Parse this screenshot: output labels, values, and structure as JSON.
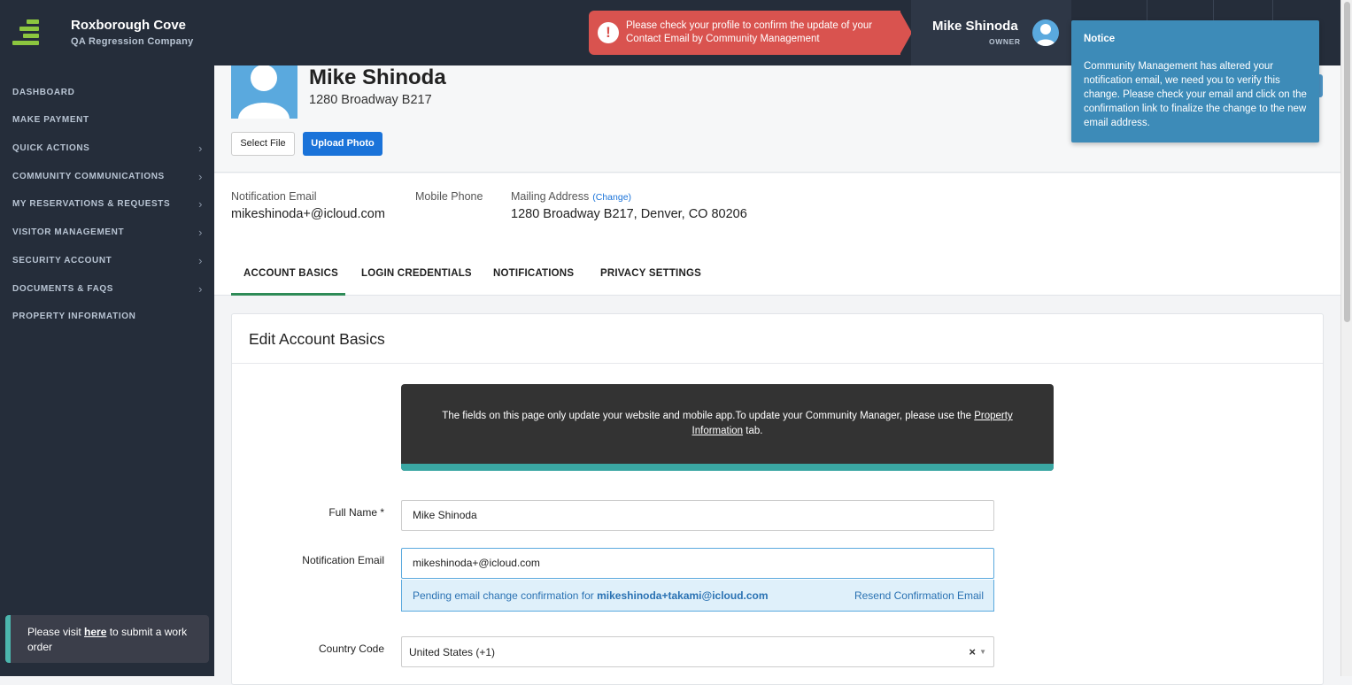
{
  "brand": {
    "name": "Roxborough Cove",
    "subtitle": "QA Regression Company"
  },
  "alert": {
    "icon": "exclamation-icon",
    "text": "Please check your profile to confirm the update of your Contact Email by Community Management"
  },
  "user": {
    "name": "Mike Shinoda",
    "role": "OWNER",
    "avatar_icon": "user-avatar-icon"
  },
  "sidebar": {
    "items": [
      {
        "label": "DASHBOARD",
        "has_chevron": false
      },
      {
        "label": "MAKE PAYMENT",
        "has_chevron": false
      },
      {
        "label": "QUICK ACTIONS",
        "has_chevron": true
      },
      {
        "label": "COMMUNITY COMMUNICATIONS",
        "has_chevron": true
      },
      {
        "label": "MY RESERVATIONS & REQUESTS",
        "has_chevron": true
      },
      {
        "label": "VISITOR MANAGEMENT",
        "has_chevron": true
      },
      {
        "label": "SECURITY ACCOUNT",
        "has_chevron": true
      },
      {
        "label": "DOCUMENTS & FAQS",
        "has_chevron": true
      },
      {
        "label": "PROPERTY INFORMATION",
        "has_chevron": false
      }
    ],
    "work_order": {
      "prefix": "Please visit ",
      "link": "here",
      "suffix": " to submit a work order"
    }
  },
  "profile": {
    "name": "Mike Shinoda",
    "address": "1280 Broadway B217",
    "select_file_label": "Select File",
    "upload_photo_label": "Upload Photo"
  },
  "info": {
    "notification_email_label": "Notification Email",
    "notification_email_value": "mikeshinoda+@icloud.com",
    "mobile_phone_label": "Mobile Phone",
    "mailing_address_label": "Mailing Address",
    "mailing_address_change": "(Change)",
    "mailing_address_value": "1280 Broadway B217, Denver, CO 80206"
  },
  "tabs": [
    {
      "label": "ACCOUNT BASICS",
      "active": true
    },
    {
      "label": "LOGIN CREDENTIALS",
      "active": false
    },
    {
      "label": "NOTIFICATIONS",
      "active": false
    },
    {
      "label": "PRIVACY SETTINGS",
      "active": false
    }
  ],
  "form": {
    "title": "Edit Account Basics",
    "note": {
      "text": "The fields on this page only update your website and mobile app.To update your Community Manager, please use the ",
      "link": "Property Information",
      "suffix": " tab."
    },
    "full_name_label": "Full Name *",
    "full_name_value": "Mike Shinoda",
    "notification_email_label": "Notification Email",
    "notification_email_value": "mikeshinoda+@icloud.com",
    "pending_prefix": "Pending email change confirmation for ",
    "pending_email": "mikeshinoda+takami@icloud.com",
    "resend_label": "Resend Confirmation Email",
    "country_code_label": "Country Code",
    "country_code_value": "United States (+1)"
  },
  "notice": {
    "title": "Notice",
    "body": "Community Management has altered your notification email, we need you to verify this change. Please check your email and click on the confirmation link to finalize the change to the new email address."
  },
  "colors": {
    "sidebar_bg": "#252d3a",
    "accent_green": "#8cc63f",
    "alert_red": "#d9534f",
    "notice_blue": "#3d8bb8",
    "primary_blue": "#1a73d9",
    "teal": "#3aa7a3"
  }
}
